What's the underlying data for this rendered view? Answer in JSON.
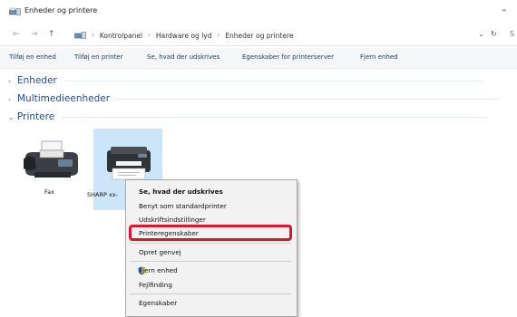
{
  "window": {
    "title": "Enheder og printere",
    "minimize_glyph": "–"
  },
  "address": {
    "back_glyph": "←",
    "forward_glyph": "→",
    "up_glyph": "↑",
    "breadcrumbs": [
      "Kontrolpanel",
      "Hardware og lyd",
      "Enheder og printere"
    ],
    "separator": "›",
    "dropdown_glyph": "⌄",
    "refresh_glyph": "↻",
    "search_glyph": "S"
  },
  "toolbar": {
    "items": [
      "Tilføj en enhed",
      "Tilføj en printer",
      "Se, hvad der udskrives",
      "Egenskaber for printerserver",
      "Fjern enhed"
    ]
  },
  "groups": [
    {
      "name": "Enheder",
      "expanded": false,
      "chevron": "›"
    },
    {
      "name": "Multimedieenheder",
      "expanded": false,
      "chevron": "›"
    },
    {
      "name": "Printere",
      "expanded": true,
      "chevron": "⌄"
    }
  ],
  "devices": [
    {
      "label": "Fax",
      "icon": "fax-icon",
      "selected": false
    },
    {
      "label": "SHARP xx-",
      "icon": "printer-icon",
      "selected": true
    }
  ],
  "context_menu": {
    "items": [
      {
        "label": "Se, hvad der udskrives",
        "bold": true
      },
      {
        "label": "Benyt som standardprinter"
      },
      {
        "label": "Udskriftsindstillinger"
      },
      {
        "label": "Printeregenskaber",
        "highlighted": true
      },
      {
        "label": "Opret genvej"
      },
      {
        "label": "Fjern enhed",
        "icon": "shield-icon"
      },
      {
        "label": "Fejlfinding"
      },
      {
        "label": "Egenskaber"
      }
    ]
  },
  "colors": {
    "highlight_border": "#d8172b",
    "selection": "#cce5f9",
    "link": "#1e4e8c"
  }
}
